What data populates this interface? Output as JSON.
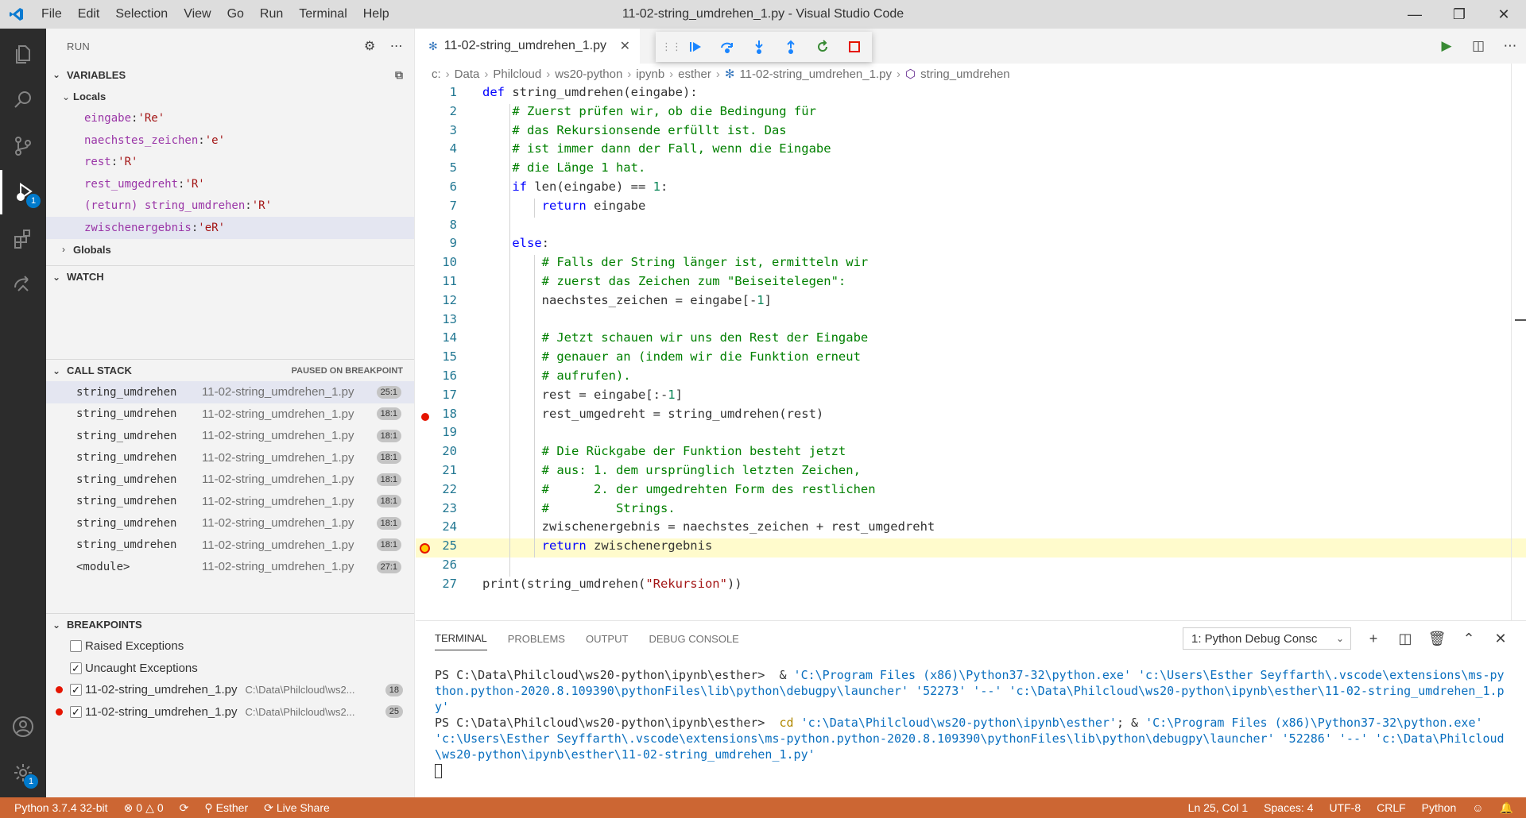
{
  "titlebar": {
    "menu": [
      "File",
      "Edit",
      "Selection",
      "View",
      "Go",
      "Run",
      "Terminal",
      "Help"
    ],
    "window_title": "11-02-string_umdrehen_1.py - Visual Studio Code"
  },
  "activitybar": {
    "items": [
      "explorer-icon",
      "search-icon",
      "source-control-icon",
      "run-debug-icon",
      "extensions-icon",
      "remote-icon"
    ],
    "run_badge": "1",
    "settings_badge": "1"
  },
  "sidebar": {
    "title": "RUN",
    "variables": {
      "header": "VARIABLES",
      "locals_label": "Locals",
      "locals": [
        {
          "name": "eingabe",
          "value": "'Re'"
        },
        {
          "name": "naechstes_zeichen",
          "value": "'e'"
        },
        {
          "name": "rest",
          "value": "'R'"
        },
        {
          "name": "rest_umgedreht",
          "value": "'R'"
        },
        {
          "name": "(return) string_umdrehen",
          "value": "'R'"
        },
        {
          "name": "zwischenergebnis",
          "value": "'eR'"
        }
      ],
      "globals_label": "Globals"
    },
    "watch": {
      "header": "WATCH"
    },
    "callstack": {
      "header": "CALL STACK",
      "status": "PAUSED ON BREAKPOINT",
      "frames": [
        {
          "fn": "string_umdrehen",
          "file": "11-02-string_umdrehen_1.py",
          "pos": "25:1"
        },
        {
          "fn": "string_umdrehen",
          "file": "11-02-string_umdrehen_1.py",
          "pos": "18:1"
        },
        {
          "fn": "string_umdrehen",
          "file": "11-02-string_umdrehen_1.py",
          "pos": "18:1"
        },
        {
          "fn": "string_umdrehen",
          "file": "11-02-string_umdrehen_1.py",
          "pos": "18:1"
        },
        {
          "fn": "string_umdrehen",
          "file": "11-02-string_umdrehen_1.py",
          "pos": "18:1"
        },
        {
          "fn": "string_umdrehen",
          "file": "11-02-string_umdrehen_1.py",
          "pos": "18:1"
        },
        {
          "fn": "string_umdrehen",
          "file": "11-02-string_umdrehen_1.py",
          "pos": "18:1"
        },
        {
          "fn": "string_umdrehen",
          "file": "11-02-string_umdrehen_1.py",
          "pos": "18:1"
        },
        {
          "fn": "<module>",
          "file": "11-02-string_umdrehen_1.py",
          "pos": "27:1"
        }
      ]
    },
    "breakpoints": {
      "header": "BREAKPOINTS",
      "raised": "Raised Exceptions",
      "uncaught": "Uncaught Exceptions",
      "items": [
        {
          "file": "11-02-string_umdrehen_1.py",
          "path": "C:\\Data\\Philcloud\\ws2...",
          "line": "18"
        },
        {
          "file": "11-02-string_umdrehen_1.py",
          "path": "C:\\Data\\Philcloud\\ws2...",
          "line": "25"
        }
      ]
    }
  },
  "editor": {
    "tab_label": "11-02-string_umdrehen_1.py",
    "breadcrumb": [
      "c:",
      "Data",
      "Philcloud",
      "ws20-python",
      "ipynb",
      "esther",
      "11-02-string_umdrehen_1.py",
      "string_umdrehen"
    ],
    "current_line": 25,
    "breakpoint_line": 18
  },
  "panel": {
    "tabs": [
      "TERMINAL",
      "PROBLEMS",
      "OUTPUT",
      "DEBUG CONSOLE"
    ],
    "terminal_select": "1: Python Debug Consc",
    "prompt": "PS C:\\Data\\Philcloud\\ws20-python\\ipynb\\esther>",
    "cmd1_amp": "&",
    "cmd1_rest": "'C:\\Program Files (x86)\\Python37-32\\python.exe' 'c:\\Users\\Esther Seyffarth\\.vscode\\extensions\\ms-python.python-2020.8.109390\\pythonFiles\\lib\\python\\debugpy\\launcher' '52273' '--' 'c:\\Data\\Philcloud\\ws20-python\\ipynb\\esther\\11-02-string_umdrehen_1.py'",
    "cmd2_cd": "cd",
    "cmd2_path": "'c:\\Data\\Philcloud\\ws20-python\\ipynb\\esther'",
    "cmd2_mid": "; &",
    "cmd2_rest": "'C:\\Program Files (x86)\\Python37-32\\python.exe' 'c:\\Users\\Esther Seyffarth\\.vscode\\extensions\\ms-python.python-2020.8.109390\\pythonFiles\\lib\\python\\debugpy\\launcher' '52286' '--' 'c:\\Data\\Philcloud\\ws20-python\\ipynb\\esther\\11-02-string_umdrehen_1.py'"
  },
  "statusbar": {
    "python": "Python 3.7.4 32-bit",
    "errors": "0",
    "warnings": "0",
    "user": "Esther",
    "liveshare": "Live Share",
    "position": "Ln 25, Col 1",
    "spaces": "Spaces: 4",
    "encoding": "UTF-8",
    "eol": "CRLF",
    "language": "Python"
  },
  "colors": {
    "statusbar": "#cc6633",
    "activitybar": "#2c2c2c",
    "current_line": "#fffbcc",
    "breakpoint": "#e51400"
  }
}
